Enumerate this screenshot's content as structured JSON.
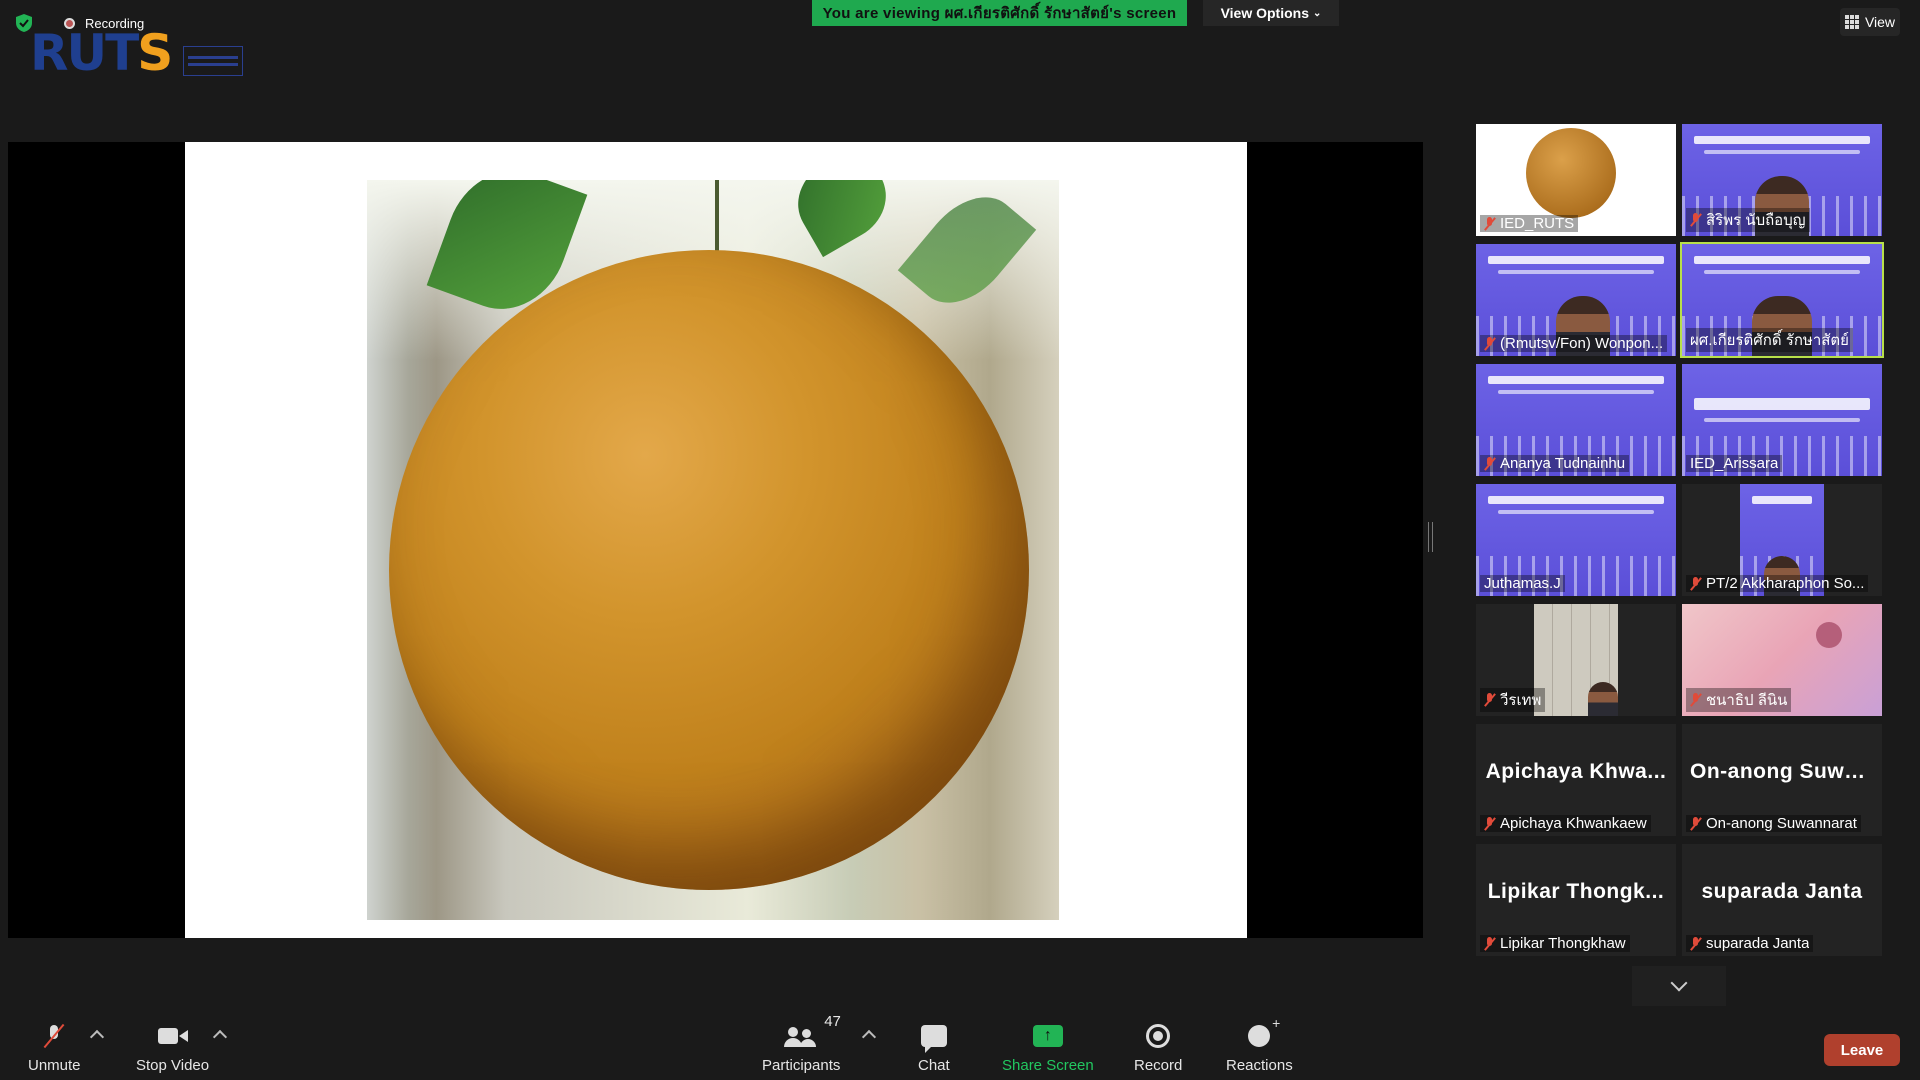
{
  "top": {
    "recording_label": "Recording",
    "brand_logo": "RUTS",
    "viewing_banner": "You are viewing ผศ.เกียรติศักดิ์ รักษาสัตย์'s screen",
    "view_options_label": "View Options",
    "view_label": "View"
  },
  "gallery": {
    "tiles": [
      {
        "name": "IED_RUTS",
        "muted": true
      },
      {
        "name": "สิริพร นับถือบุญ",
        "muted": true
      },
      {
        "name": "(Rmutsv/Fon) Wonpon...",
        "muted": true
      },
      {
        "name": "ผศ.เกียรติศักดิ์ รักษาสัตย์",
        "muted": false,
        "active": true
      },
      {
        "name": "Ananya Tudnainhu",
        "muted": true
      },
      {
        "name": "IED_Arissara",
        "muted": false
      },
      {
        "name": "Juthamas.J",
        "muted": false
      },
      {
        "name": "PT/2 Akkharaphon So...",
        "muted": true
      },
      {
        "name": "วีรเทพ",
        "muted": true
      },
      {
        "name": "ชนาธิป ลีนิน",
        "muted": true
      },
      {
        "name": "Apichaya Khwankaew",
        "big_name": "Apichaya Khwa...",
        "muted": true
      },
      {
        "name": "On-anong Suwannarat",
        "big_name": "On-anong Suwa...",
        "muted": true
      },
      {
        "name": "Lipikar Thongkhaw",
        "big_name": "Lipikar Thongk...",
        "muted": true
      },
      {
        "name": "suparada  Janta",
        "big_name": "suparada  Janta",
        "muted": true
      }
    ]
  },
  "toolbar": {
    "unmute_label": "Unmute",
    "stop_video_label": "Stop Video",
    "participants_label": "Participants",
    "participants_count": "47",
    "chat_label": "Chat",
    "share_screen_label": "Share Screen",
    "record_label": "Record",
    "reactions_label": "Reactions",
    "leave_label": "Leave"
  },
  "colors": {
    "banner_green": "#1fa94f",
    "leave_red": "#b0402d",
    "active_speaker": "#b8e04a",
    "share_green": "#22b455"
  }
}
